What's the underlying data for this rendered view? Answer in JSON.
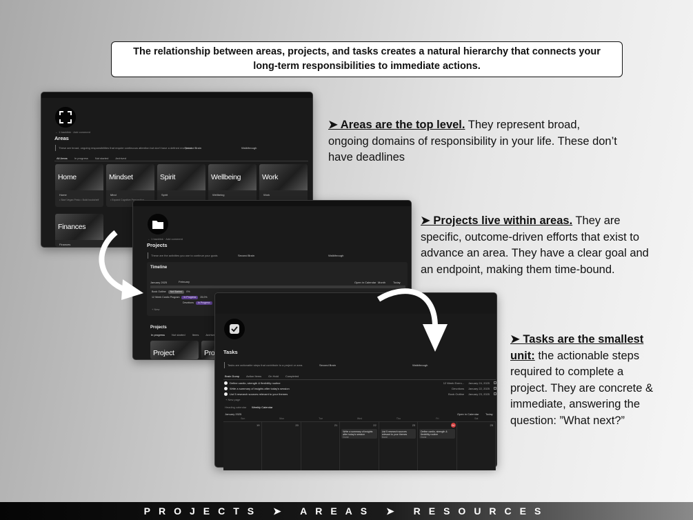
{
  "heading": "The relationship between areas, projects, and tasks creates a natural hierarchy that connects your long-term responsibilities to immediate actions.",
  "areas_shot": {
    "breadcrumb": "← 1 backlink   · Add comment",
    "title": "Areas",
    "description": "These are broad, ongoing responsibilities that require continuous attention but don't have a defined end point.",
    "link_second_brain": "Second Brain",
    "link_walkthrough": "Walkthrough",
    "tabs": [
      "All Areas",
      "In progress",
      "Not started",
      "Archived"
    ],
    "cards": [
      {
        "title": "Home",
        "label": "Home",
        "sub": "• Start Vegan Pesto  • Build bookshelf"
      },
      {
        "title": "Mindset",
        "label": "Mind",
        "sub": "• Expand Cognitive Perspective"
      },
      {
        "title": "Spirit",
        "label": "Spirit",
        "sub": ""
      },
      {
        "title": "Wellbeing",
        "label": "Wellbeing",
        "sub": ""
      },
      {
        "title": "Work",
        "label": "Work",
        "sub": ""
      },
      {
        "title": "Finances",
        "label": "Finances",
        "sub": ""
      }
    ]
  },
  "projects_shot": {
    "breadcrumb": "← 1 backlink   · Add comment",
    "title": "Projects",
    "description": "These are the activities you use to continue your goals",
    "link_second_brain": "Second Brain",
    "link_walkthrough": "Walkthrough",
    "timeline_title": "Timeline",
    "timeline_month": "January 2025",
    "timeline_month2": "February",
    "open_in_calendar": "Open in Calendar",
    "month_label": "Month",
    "today_label": "Today",
    "rows": [
      {
        "name": "Book Outline",
        "status": "Not Started",
        "extra": "0%"
      },
      {
        "name": "12 Week Cardio Program",
        "status": "In Progress",
        "extra": "25.0%"
      },
      {
        "name": "Devotions",
        "status": "In Progress",
        "extra": ""
      }
    ],
    "new_label": "+ New",
    "projects_title": "Projects",
    "projects_tabs": [
      "In progress",
      "Not started",
      "Items",
      "Archived"
    ],
    "project_cards": [
      "Project",
      "Pro"
    ]
  },
  "tasks_shot": {
    "title": "Tasks",
    "description": "Tasks are actionable steps that contribute to a project or area.",
    "link_second_brain": "Second Brain",
    "link_walkthrough": "Walkthrough",
    "tabs": [
      "Brain Dump",
      "Action Items",
      "On Hold",
      "Completed"
    ],
    "tasks": [
      {
        "name": "Define cardio, strength & flexibility routine",
        "project": "12 Week Exerc...",
        "date": "January 24, 2025"
      },
      {
        "name": "Write a summary of insights after today's session",
        "project": "Devotions",
        "date": "January 22, 2025"
      },
      {
        "name": "List 5 research sources relevant to your themes",
        "project": "Book Outline",
        "date": "January 23, 2025"
      }
    ],
    "new_page": "+ New page",
    "view_tabs": [
      "Weekly Calendar"
    ],
    "view_tab_active": "Weekly Calendar",
    "view_tab_other": "Heading calendar",
    "cal_month": "January 2025",
    "cal_open": "Open in Calendar",
    "cal_today": "Today",
    "weekdays": [
      "Sun",
      "Mon",
      "Tue",
      "Wed",
      "Thu",
      "Fri",
      "Sat"
    ],
    "day_numbers": [
      "19",
      "20",
      "21",
      "22",
      "23",
      "24",
      "25"
    ],
    "cal_cards": [
      {
        "day": 3,
        "text": "Write a summary of insights after today's session",
        "done": "Done"
      },
      {
        "day": 4,
        "text": "List 5 research sources relevant to your themes",
        "done": "Done"
      },
      {
        "day": 5,
        "text": "Define cardio, strength & flexibility routine",
        "done": "Done"
      }
    ]
  },
  "captions": {
    "areas": {
      "bold": "➤ Areas are the top level.",
      "rest": " They represent broad, ongoing domains of responsibility in your life. These don’t have deadlines"
    },
    "projects": {
      "bold": "➤ Projects live within areas.",
      "rest": " They are specific, outcome-driven efforts that exist to advance an area. They have a clear goal and an endpoint, making them time-bound."
    },
    "tasks": {
      "bold": "➤ Tasks are the smallest unit:",
      "rest": " the actionable steps required to complete a project. They are concrete & immediate, answering the question: ”What next?”"
    }
  },
  "footer": "PROJECTS ➤ AREAS ➤ RESOURCES",
  "colors": {
    "accent_red": "#d23b3b",
    "in_progress": "#5b3f8c"
  }
}
